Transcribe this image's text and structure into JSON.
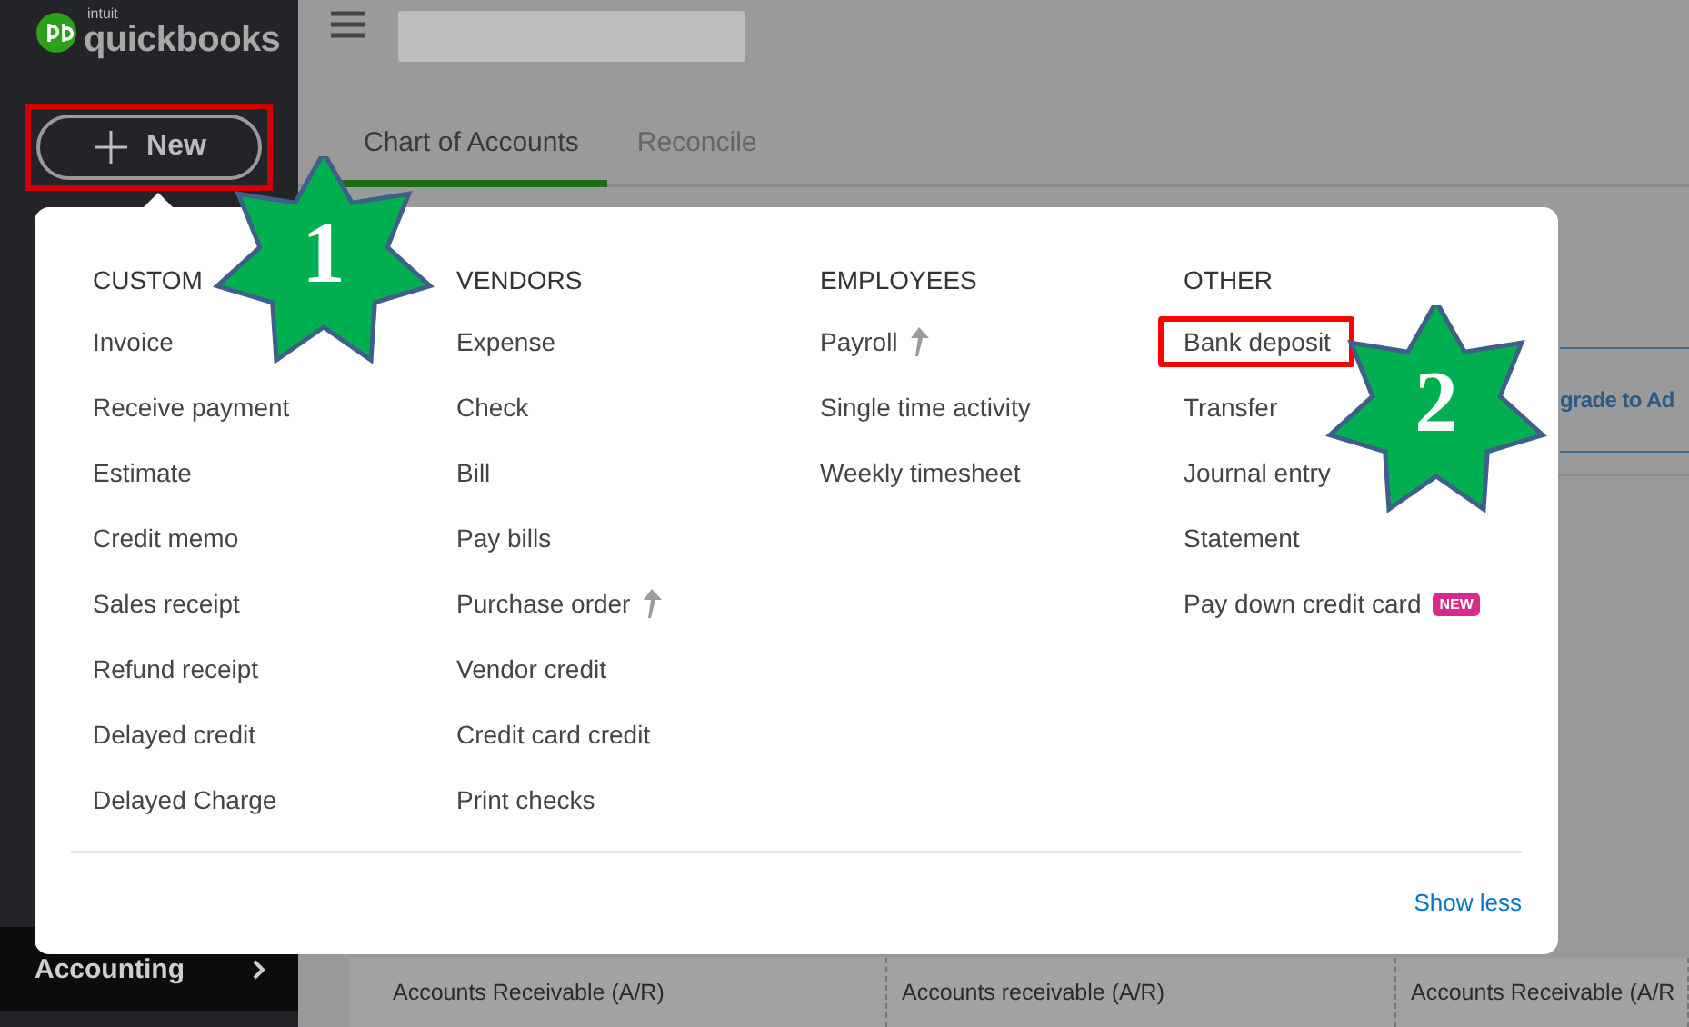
{
  "sidebar": {
    "logo": {
      "brand": "intuit",
      "product": "quickbooks"
    },
    "new_button": {
      "label": "New",
      "highlighted": true
    },
    "items": [
      {
        "label": "Accounting"
      }
    ]
  },
  "tabs": [
    {
      "label": "Chart of Accounts",
      "selected": true
    },
    {
      "label": "Reconcile",
      "selected": false
    }
  ],
  "upgrade_link": "grade to Ad",
  "table_row": [
    "Accounts Receivable (A/R)",
    "Accounts receivable (A/R)",
    "Accounts Receivable (A/R"
  ],
  "new_menu": {
    "columns": [
      {
        "heading": "CUSTOM",
        "items": [
          {
            "label": "Invoice",
            "kind": "plain",
            "highlighted": false
          },
          {
            "label": "Receive payment",
            "kind": "plain",
            "highlighted": false
          },
          {
            "label": "Estimate",
            "kind": "plain",
            "highlighted": false
          },
          {
            "label": "Credit memo",
            "kind": "plain",
            "highlighted": false
          },
          {
            "label": "Sales receipt",
            "kind": "plain",
            "highlighted": false
          },
          {
            "label": "Refund receipt",
            "kind": "plain",
            "highlighted": false
          },
          {
            "label": "Delayed credit",
            "kind": "plain",
            "highlighted": false
          },
          {
            "label": "Delayed Charge",
            "kind": "plain",
            "highlighted": false
          }
        ]
      },
      {
        "heading": "VENDORS",
        "items": [
          {
            "label": "Expense",
            "kind": "plain",
            "highlighted": false
          },
          {
            "label": "Check",
            "kind": "plain",
            "highlighted": false
          },
          {
            "label": "Bill",
            "kind": "plain",
            "highlighted": false
          },
          {
            "label": "Pay bills",
            "kind": "plain",
            "highlighted": false
          },
          {
            "label": "Purchase order",
            "kind": "upgrade",
            "highlighted": false
          },
          {
            "label": "Vendor credit",
            "kind": "plain",
            "highlighted": false
          },
          {
            "label": "Credit card credit",
            "kind": "plain",
            "highlighted": false
          },
          {
            "label": "Print checks",
            "kind": "plain",
            "highlighted": false
          }
        ]
      },
      {
        "heading": "EMPLOYEES",
        "items": [
          {
            "label": "Payroll",
            "kind": "upgrade",
            "highlighted": false
          },
          {
            "label": "Single time activity",
            "kind": "plain",
            "highlighted": false
          },
          {
            "label": "Weekly timesheet",
            "kind": "plain",
            "highlighted": false
          }
        ]
      },
      {
        "heading": "OTHER",
        "items": [
          {
            "label": "Bank deposit",
            "kind": "plain",
            "highlighted": true
          },
          {
            "label": "Transfer",
            "kind": "plain",
            "highlighted": false
          },
          {
            "label": "Journal entry",
            "kind": "plain",
            "highlighted": false
          },
          {
            "label": "Statement",
            "kind": "plain",
            "highlighted": false
          },
          {
            "label": "Pay down credit card",
            "kind": "badge",
            "badge": "NEW",
            "highlighted": false
          }
        ]
      }
    ],
    "footer_link": "Show less"
  },
  "annotations": [
    {
      "number": "1"
    },
    {
      "number": "2"
    }
  ]
}
